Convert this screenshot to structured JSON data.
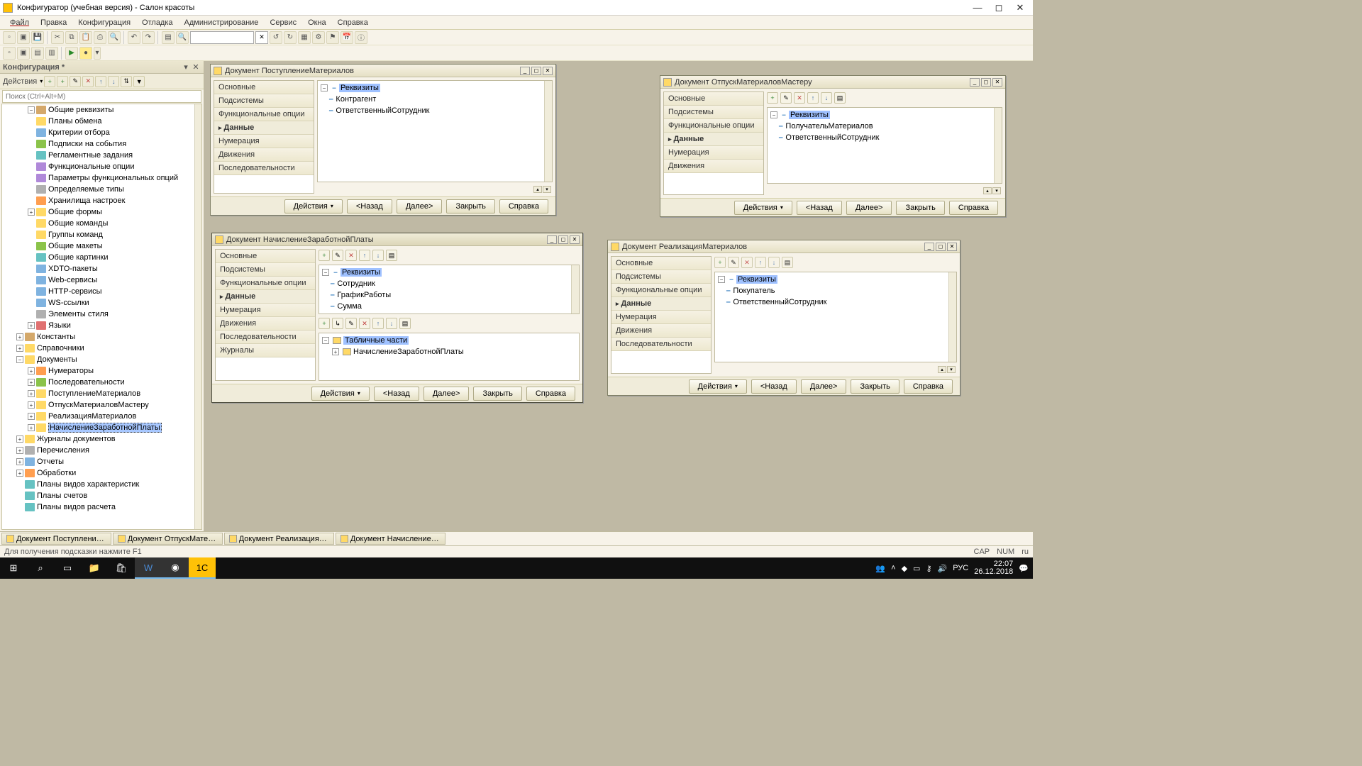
{
  "app": {
    "title": "Конфигуратор (учебная версия) - Салон красоты"
  },
  "menu": [
    "Файл",
    "Правка",
    "Конфигурация",
    "Отладка",
    "Администрирование",
    "Сервис",
    "Окна",
    "Справка"
  ],
  "configPanel": {
    "title": "Конфигурация *",
    "actionsLabel": "Действия",
    "searchPlaceholder": "Поиск (Ctrl+Alt+M)"
  },
  "tree": [
    {
      "l": "Общие реквизиты",
      "i": 1,
      "exp": "−",
      "ic": "cube"
    },
    {
      "l": "Планы обмена",
      "i": 1,
      "ic": "yel"
    },
    {
      "l": "Критерии отбора",
      "i": 1,
      "ic": "blu"
    },
    {
      "l": "Подписки на события",
      "i": 1,
      "ic": "grn"
    },
    {
      "l": "Регламентные задания",
      "i": 1,
      "ic": "cyn"
    },
    {
      "l": "Функциональные опции",
      "i": 1,
      "ic": "pur"
    },
    {
      "l": "Параметры функциональных опций",
      "i": 1,
      "ic": "pur"
    },
    {
      "l": "Определяемые типы",
      "i": 1,
      "ic": "gry"
    },
    {
      "l": "Хранилища настроек",
      "i": 1,
      "ic": "org"
    },
    {
      "l": "Общие формы",
      "i": 1,
      "exp": "+",
      "ic": "yel"
    },
    {
      "l": "Общие команды",
      "i": 1,
      "ic": "yel"
    },
    {
      "l": "Группы команд",
      "i": 1,
      "ic": "yel"
    },
    {
      "l": "Общие макеты",
      "i": 1,
      "ic": "grn"
    },
    {
      "l": "Общие картинки",
      "i": 1,
      "ic": "cyn"
    },
    {
      "l": "XDTO-пакеты",
      "i": 1,
      "ic": "blu"
    },
    {
      "l": "Web-сервисы",
      "i": 1,
      "ic": "blu"
    },
    {
      "l": "HTTP-сервисы",
      "i": 1,
      "ic": "blu"
    },
    {
      "l": "WS-ссылки",
      "i": 1,
      "ic": "blu"
    },
    {
      "l": "Элементы стиля",
      "i": 1,
      "ic": "gry"
    },
    {
      "l": "Языки",
      "i": 1,
      "exp": "+",
      "ic": "red"
    },
    {
      "l": "Константы",
      "i": 0,
      "exp": "+",
      "ic": "cube"
    },
    {
      "l": "Справочники",
      "i": 0,
      "exp": "+",
      "ic": "yel"
    },
    {
      "l": "Документы",
      "i": 0,
      "exp": "−",
      "ic": "yel"
    },
    {
      "l": "Нумераторы",
      "i": 1,
      "exp": "+",
      "ic": "org"
    },
    {
      "l": "Последовательности",
      "i": 1,
      "exp": "+",
      "ic": "grn"
    },
    {
      "l": "ПоступлениеМатериалов",
      "i": 1,
      "exp": "+",
      "ic": "yel"
    },
    {
      "l": "ОтпускМатериаловМастеру",
      "i": 1,
      "exp": "+",
      "ic": "yel"
    },
    {
      "l": "РеализацияМатериалов",
      "i": 1,
      "exp": "+",
      "ic": "yel"
    },
    {
      "l": "НачислениеЗаработнойПлаты",
      "i": 1,
      "exp": "+",
      "ic": "yel",
      "sel": true
    },
    {
      "l": "Журналы документов",
      "i": 0,
      "exp": "+",
      "ic": "yel"
    },
    {
      "l": "Перечисления",
      "i": 0,
      "exp": "+",
      "ic": "gry"
    },
    {
      "l": "Отчеты",
      "i": 0,
      "exp": "+",
      "ic": "blu"
    },
    {
      "l": "Обработки",
      "i": 0,
      "exp": "+",
      "ic": "org"
    },
    {
      "l": "Планы видов характеристик",
      "i": 0,
      "ic": "cyn"
    },
    {
      "l": "Планы счетов",
      "i": 0,
      "ic": "cyn"
    },
    {
      "l": "Планы видов расчета",
      "i": 0,
      "ic": "cyn"
    }
  ],
  "cats7": [
    "Основные",
    "Подсистемы",
    "Функциональные опции",
    "Данные",
    "Нумерация",
    "Движения",
    "Последовательности"
  ],
  "cats8": [
    "Основные",
    "Подсистемы",
    "Функциональные опции",
    "Данные",
    "Нумерация",
    "Движения",
    "Последовательности",
    "Журналы"
  ],
  "cats6": [
    "Основные",
    "Подсистемы",
    "Функциональные опции",
    "Данные",
    "Нумерация",
    "Движения"
  ],
  "labels": {
    "rekvizity": "Реквизиты",
    "tabparts": "Табличные части"
  },
  "docA": {
    "title": "Документ ПоступлениеМатериалов",
    "attrs": [
      "Контрагент",
      "ОтветственныйСотрудник"
    ]
  },
  "docB": {
    "title": "Документ ОтпускМатериаловМастеру",
    "attrs": [
      "ПолучательМатериалов",
      "ОтветственныйСотрудник"
    ]
  },
  "docC": {
    "title": "Документ НачислениеЗаработнойПлаты",
    "attrs": [
      "Сотрудник",
      "ГрафикРаботы",
      "Сумма"
    ],
    "tab": [
      "НачислениеЗаработнойПлаты"
    ]
  },
  "docD": {
    "title": "Документ РеализацияМатериалов",
    "attrs": [
      "Покупатель",
      "ОтветственныйСотрудник"
    ]
  },
  "footbtns": {
    "actions": "Действия",
    "back": "<Назад",
    "next": "Далее>",
    "close": "Закрыть",
    "help": "Справка"
  },
  "dockTabs": [
    "Документ Поступление...",
    "Документ ОтпускМатер...",
    "Документ РеализацияМ...",
    "Документ НачислениеЗ..."
  ],
  "status": {
    "hint": "Для получения подсказки нажмите F1",
    "cap": "CAP",
    "num": "NUM",
    "ru": "ru"
  },
  "wtask": {
    "lang": "РУС",
    "time": "22:07",
    "date": "26.12.2018"
  }
}
